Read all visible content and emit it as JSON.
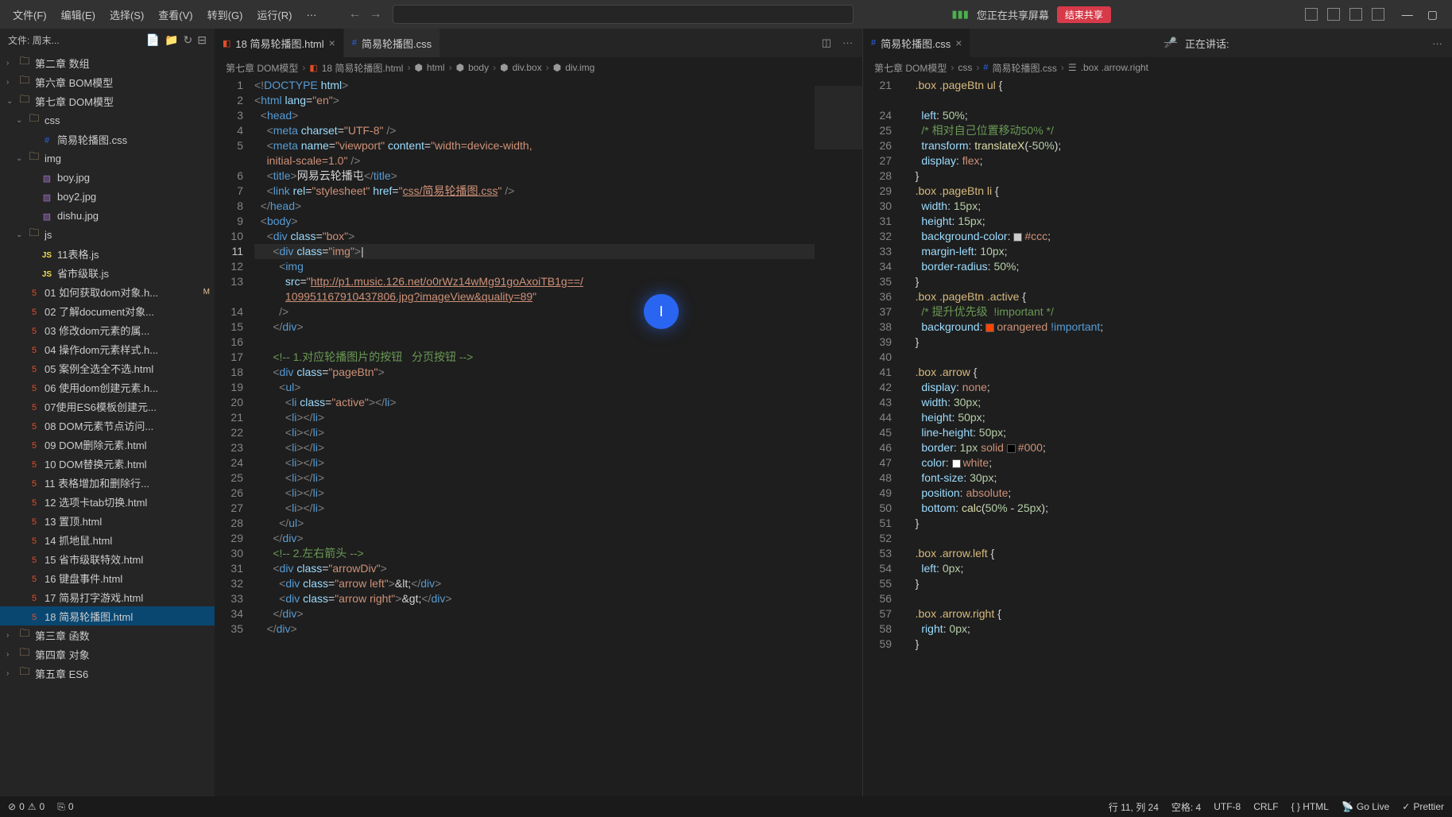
{
  "menubar": {
    "items": [
      "文件(F)",
      "编辑(E)",
      "选择(S)",
      "查看(V)",
      "转到(G)",
      "运行(R)"
    ],
    "dots": "···"
  },
  "share": {
    "text": "您正在共享屏幕",
    "btn": "结束共享"
  },
  "sidebar": {
    "header": "文件: 周末...",
    "tree": [
      {
        "label": "第二章 数组",
        "type": "folder",
        "chev": ">",
        "indent": 0
      },
      {
        "label": "第六章 BOM模型",
        "type": "folder",
        "chev": ">",
        "indent": 0
      },
      {
        "label": "第七章 DOM模型",
        "type": "folder",
        "chev": "v",
        "indent": 0
      },
      {
        "label": "css",
        "type": "folder",
        "chev": "v",
        "indent": 1
      },
      {
        "label": "简易轮播图.css",
        "type": "css",
        "indent": 2
      },
      {
        "label": "img",
        "type": "folder",
        "chev": "v",
        "indent": 1
      },
      {
        "label": "boy.jpg",
        "type": "img",
        "indent": 2
      },
      {
        "label": "boy2.jpg",
        "type": "img",
        "indent": 2
      },
      {
        "label": "dishu.jpg",
        "type": "img",
        "indent": 2
      },
      {
        "label": "js",
        "type": "folder",
        "chev": "v",
        "indent": 1
      },
      {
        "label": "11表格.js",
        "type": "js",
        "indent": 2
      },
      {
        "label": "省市级联.js",
        "type": "js",
        "indent": 2
      },
      {
        "label": "01 如何获取dom对象.h...",
        "type": "html",
        "indent": 1,
        "git": "M"
      },
      {
        "label": "02 了解document对象...",
        "type": "html",
        "indent": 1
      },
      {
        "label": "03 修改dom元素的属...",
        "type": "html",
        "indent": 1
      },
      {
        "label": "04 操作dom元素样式.h...",
        "type": "html",
        "indent": 1
      },
      {
        "label": "05 案例全选全不选.html",
        "type": "html",
        "indent": 1
      },
      {
        "label": "06 使用dom创建元素.h...",
        "type": "html",
        "indent": 1
      },
      {
        "label": "07使用ES6模板创建元...",
        "type": "html",
        "indent": 1
      },
      {
        "label": "08 DOM元素节点访问...",
        "type": "html",
        "indent": 1
      },
      {
        "label": "09 DOM删除元素.html",
        "type": "html",
        "indent": 1
      },
      {
        "label": "10 DOM替换元素.html",
        "type": "html",
        "indent": 1
      },
      {
        "label": "11 表格增加和删除行...",
        "type": "html",
        "indent": 1
      },
      {
        "label": "12 选项卡tab切换.html",
        "type": "html",
        "indent": 1
      },
      {
        "label": "13 置顶.html",
        "type": "html",
        "indent": 1
      },
      {
        "label": "14 抓地鼠.html",
        "type": "html",
        "indent": 1
      },
      {
        "label": "15 省市级联特效.html",
        "type": "html",
        "indent": 1
      },
      {
        "label": "16 键盘事件.html",
        "type": "html",
        "indent": 1
      },
      {
        "label": "17 简易打字游戏.html",
        "type": "html",
        "indent": 1
      },
      {
        "label": "18 简易轮播图.html",
        "type": "html",
        "indent": 1,
        "active": true
      },
      {
        "label": "第三章 函数",
        "type": "folder",
        "chev": ">",
        "indent": 0
      },
      {
        "label": "第四章 对象",
        "type": "folder",
        "chev": ">",
        "indent": 0
      },
      {
        "label": "第五章 ES6",
        "type": "folder",
        "chev": ">",
        "indent": 0
      }
    ]
  },
  "editor1": {
    "tabs": [
      {
        "label": "18 简易轮播图.html",
        "icon": "html",
        "active": true,
        "close": true
      },
      {
        "label": "简易轮播图.css",
        "icon": "css",
        "active": false
      }
    ],
    "breadcrumb": [
      "第七章 DOM模型",
      "18 简易轮播图.html",
      "html",
      "body",
      "div.box",
      "div.img"
    ],
    "lineStart": 1,
    "currentLine": 11
  },
  "editor2": {
    "tab": {
      "label": "简易轮播图.css",
      "icon": "css"
    },
    "voice": "正在讲话:",
    "breadcrumb": [
      "第七章 DOM模型",
      "css",
      "简易轮播图.css",
      ".box .arrow.right"
    ],
    "lineStart": 21
  },
  "statusbar": {
    "errors": "0",
    "warnings": "0",
    "port": "0",
    "cursor": "行 11, 列 24",
    "spaces": "空格: 4",
    "encoding": "UTF-8",
    "eol": "CRLF",
    "lang": "{ } HTML",
    "golive": "Go Live",
    "prettier": "Prettier"
  }
}
